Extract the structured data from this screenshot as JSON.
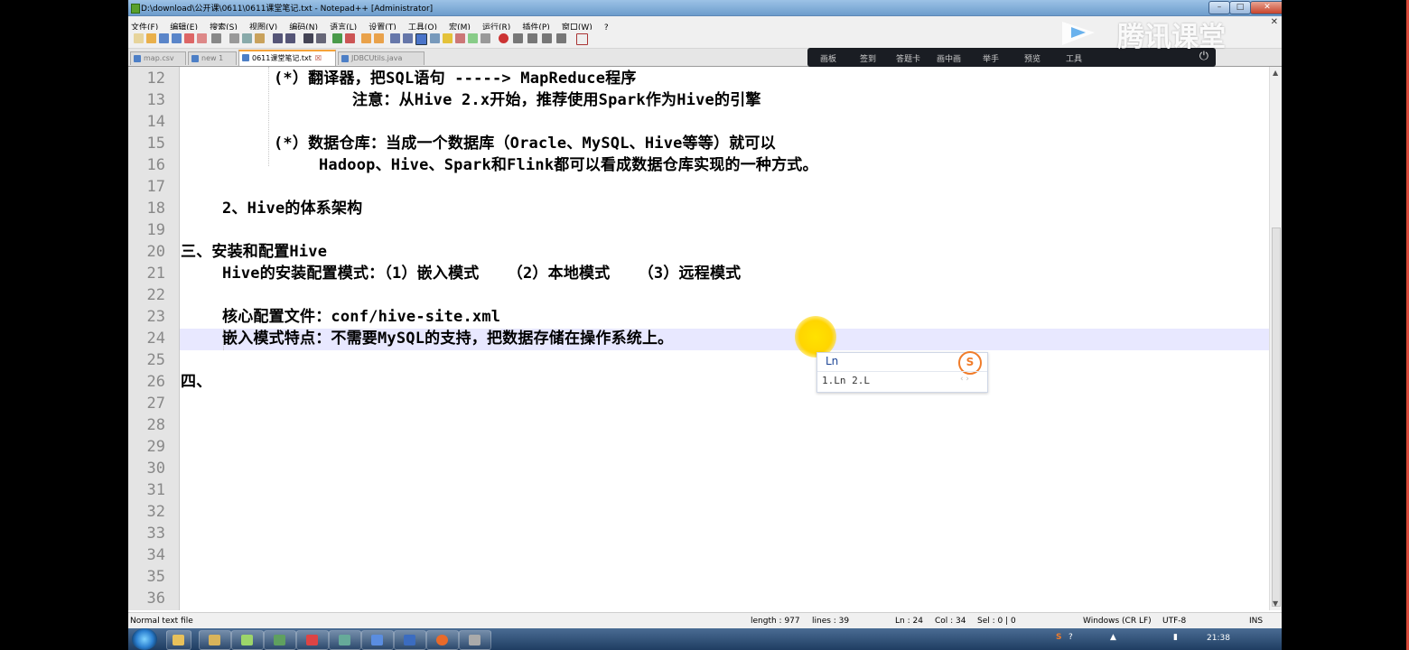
{
  "titlebar": {
    "title": "D:\\download\\公开课\\0611\\0611课堂笔记.txt - Notepad++ [Administrator]"
  },
  "menubar": [
    "文件(F)",
    "编辑(E)",
    "搜索(S)",
    "视图(V)",
    "编码(N)",
    "语言(L)",
    "设置(T)",
    "工具(O)",
    "宏(M)",
    "运行(R)",
    "插件(P)",
    "窗口(W)",
    "?"
  ],
  "tabs": [
    {
      "label": "map.csv"
    },
    {
      "label": "new 1"
    },
    {
      "label": "0611课堂笔记.txt",
      "active": true
    },
    {
      "label": "JDBCUtils.java"
    }
  ],
  "overlay": {
    "items": [
      "画板",
      "签到",
      "答题卡",
      "画中画",
      "举手",
      "预览",
      "工具"
    ]
  },
  "brand": "腾讯课堂",
  "editor": {
    "lines": [
      {
        "num": "12",
        "text": "(*）翻译器，把SQL语句 -----> MapReduce程序"
      },
      {
        "num": "13",
        "text": "注意：从Hive 2.x开始，推荐使用Spark作为Hive的引擎"
      },
      {
        "num": "14",
        "text": ""
      },
      {
        "num": "15",
        "text": "(*）数据仓库：当成一个数据库（Oracle、MySQL、Hive等等）就可以"
      },
      {
        "num": "16",
        "text": "Hadoop、Hive、Spark和Flink都可以看成数据仓库实现的一种方式。"
      },
      {
        "num": "17",
        "text": ""
      },
      {
        "num": "18",
        "text": "2、Hive的体系架构"
      },
      {
        "num": "19",
        "text": ""
      },
      {
        "num": "20",
        "text": "三、安装和配置Hive"
      },
      {
        "num": "21",
        "text": "Hive的安装配置模式：（1）嵌入模式   （2）本地模式   （3）远程模式"
      },
      {
        "num": "22",
        "text": ""
      },
      {
        "num": "23",
        "text": "核心配置文件：conf/hive-site.xml"
      },
      {
        "num": "24",
        "text": "嵌入模式特点：不需要MySQL的支持，把数据存储在操作系统上。"
      },
      {
        "num": "25",
        "text": ""
      },
      {
        "num": "26",
        "text": "四、"
      },
      {
        "num": "27",
        "text": ""
      },
      {
        "num": "28",
        "text": ""
      },
      {
        "num": "29",
        "text": ""
      },
      {
        "num": "30",
        "text": ""
      },
      {
        "num": "31",
        "text": ""
      },
      {
        "num": "32",
        "text": ""
      },
      {
        "num": "33",
        "text": ""
      },
      {
        "num": "34",
        "text": ""
      },
      {
        "num": "35",
        "text": ""
      },
      {
        "num": "36",
        "text": ""
      }
    ],
    "current_line": "24"
  },
  "ime": {
    "input": "Ln",
    "logo": "S",
    "candidates": "1.Ln  2.L",
    "pager": "‹ ›"
  },
  "statusbar": {
    "filetype": "Normal text file",
    "length": "length : 977",
    "lines": "lines : 39",
    "ln": "Ln : 24",
    "col": "Col : 34",
    "sel": "Sel : 0 | 0",
    "eol": "Windows (CR LF)",
    "encoding": "UTF-8",
    "mode": "INS"
  },
  "taskbar": {
    "clock": "21:38"
  },
  "colors": {
    "current_line": "#e8e8ff",
    "gutter": "#e4e4e4",
    "active_tab_accent": "#f6a339",
    "frame_red": "#d84a3a"
  }
}
